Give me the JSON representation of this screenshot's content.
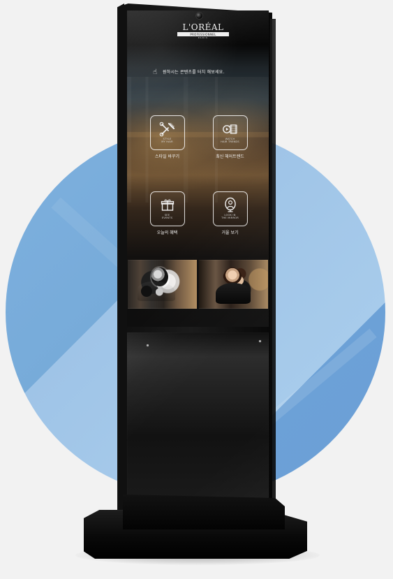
{
  "brand": {
    "title": "L'ORÉAL",
    "sub": "PROFESSIONNEL",
    "city": "PARIS"
  },
  "touch_prompt": {
    "icon": "touch-icon",
    "text": "원하시는 콘텐츠를 터치 해보세요."
  },
  "menu": [
    {
      "icon": "scissors-comb-icon",
      "english": "STYLE\nMY HAIR",
      "label": "스타일 바꾸기"
    },
    {
      "icon": "video-icon",
      "english": "WATCH\nHAIR TRENDS",
      "label": "최신 헤어트렌드"
    },
    {
      "icon": "gift-icon",
      "english": "SEE\nEVENTS",
      "label": "오늘의 혜택"
    },
    {
      "icon": "mirror-user-icon",
      "english": "LOOK IN\nTHE MIRROR",
      "label": "거울 보기"
    }
  ],
  "colors": {
    "background": "#f2f2f2",
    "circle_blue_dark": "#6c9fd6",
    "circle_blue_light": "#a7cbeb",
    "kiosk_black": "#0f0f0f"
  }
}
